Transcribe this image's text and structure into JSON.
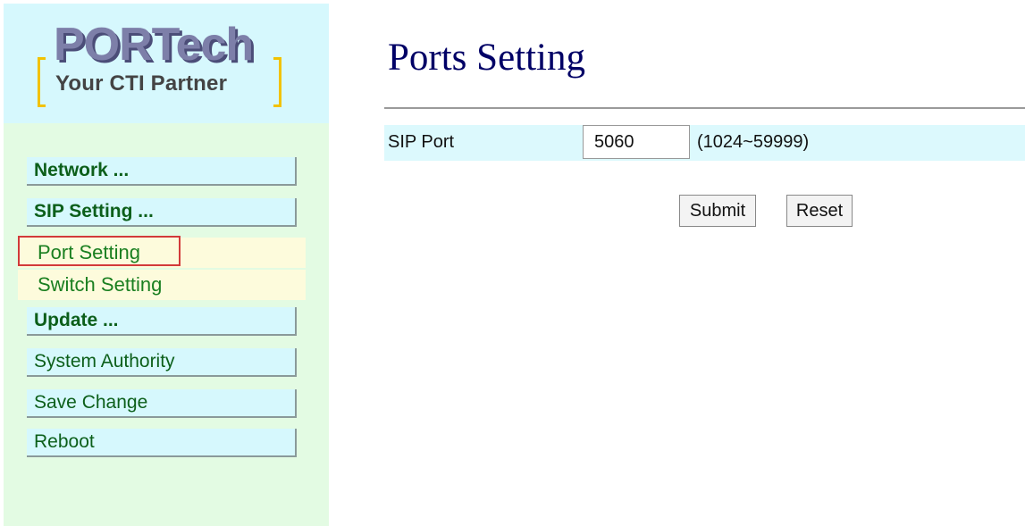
{
  "logo": {
    "brand": "PORTech",
    "tagline": "Your CTI Partner"
  },
  "sidebar": {
    "items": [
      {
        "label": "Network ..."
      },
      {
        "label": "SIP Setting ..."
      },
      {
        "label": "Port Setting",
        "selected": true
      },
      {
        "label": "Switch Setting"
      },
      {
        "label": "Update ..."
      },
      {
        "label": "System Authority"
      },
      {
        "label": "Save Change"
      },
      {
        "label": "Reboot"
      }
    ]
  },
  "main": {
    "title": "Ports Setting",
    "sip_port": {
      "label": "SIP Port",
      "value": "5060",
      "range": "(1024~59999)"
    },
    "buttons": {
      "submit": "Submit",
      "reset": "Reset"
    }
  },
  "colors": {
    "title": "#000066",
    "menu_text": "#0c5f1a",
    "sidebar_bg": "#e3fbe3",
    "menu_bg": "#d6f8fd",
    "submenu_bg": "#fdfbdc",
    "selection_border": "#d23a3a"
  }
}
